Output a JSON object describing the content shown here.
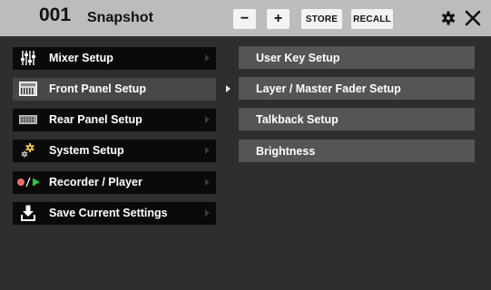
{
  "header": {
    "snapshot_number": "001",
    "title": "Snapshot",
    "minus_label": "−",
    "plus_label": "+",
    "store_label": "STORE",
    "recall_label": "RECALL",
    "gear_icon": "gear-icon",
    "close_icon": "close-icon"
  },
  "menu": {
    "items": [
      {
        "label": "Mixer Setup",
        "icon": "mixer-faders-icon",
        "selected": false
      },
      {
        "label": "Front Panel Setup",
        "icon": "front-panel-icon",
        "selected": true
      },
      {
        "label": "Rear Panel Setup",
        "icon": "rear-panel-icon",
        "selected": false
      },
      {
        "label": "System Setup",
        "icon": "gears-icon",
        "selected": false
      },
      {
        "label": "Recorder / Player",
        "icon": "record-play-icon",
        "selected": false
      },
      {
        "label": "Save Current Settings",
        "icon": "save-download-icon",
        "selected": false
      }
    ]
  },
  "submenu": {
    "items": [
      {
        "label": "User Key Setup"
      },
      {
        "label": "Layer / Master Fader Setup"
      },
      {
        "label": "Talkback Setup"
      },
      {
        "label": "Brightness"
      }
    ]
  },
  "colors": {
    "header_bg": "#bcbcbc",
    "body_bg": "#2e2e2e",
    "menu_bg": "#0a0a0a",
    "menu_selected_bg": "#474747",
    "submenu_bg": "#555555",
    "record_red": "#ef6a6a",
    "play_green": "#2cc24a"
  }
}
